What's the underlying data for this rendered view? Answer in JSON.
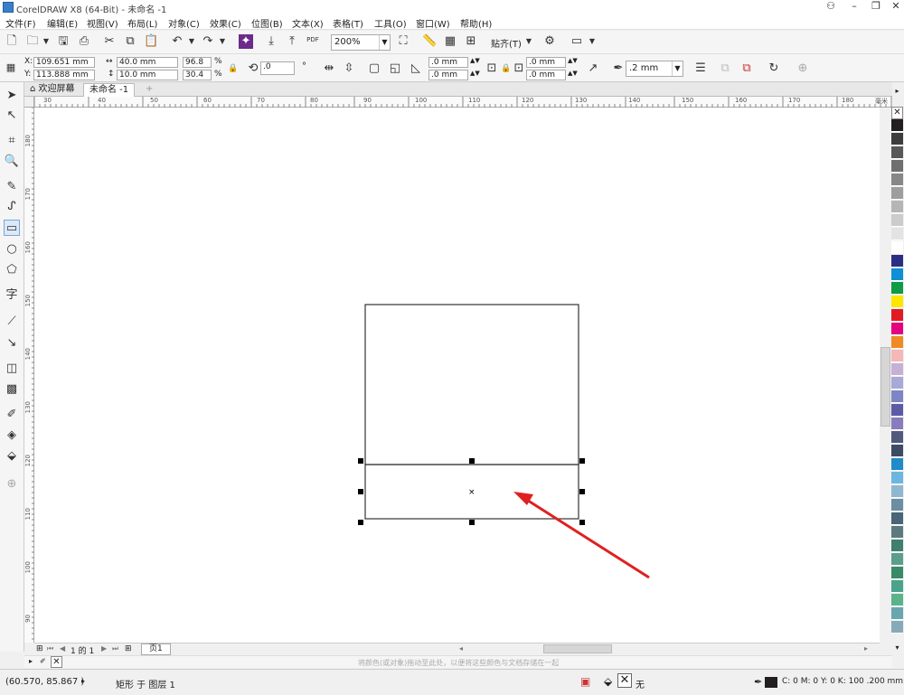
{
  "window": {
    "title": "CorelDRAW X8 (64-Bit) - 未命名 -1"
  },
  "menu": [
    "文件(F)",
    "编辑(E)",
    "视图(V)",
    "布局(L)",
    "对象(C)",
    "效果(C)",
    "位图(B)",
    "文本(X)",
    "表格(T)",
    "工具(O)",
    "窗口(W)",
    "帮助(H)"
  ],
  "toolbar": {
    "zoom": "200%",
    "snap_label": "贴齐(T)",
    "pdf_label": "PDF"
  },
  "propbar": {
    "x_label": "X:",
    "x_value": "109.651 mm",
    "y_label": "Y:",
    "y_value": "113.888 mm",
    "width_value": "40.0 mm",
    "height_value": "10.0 mm",
    "scale_x": "96.8",
    "scale_y": "30.4",
    "percent": "%",
    "rotation": ".0",
    "rotation_unit": "°",
    "corner_1": ".0 mm",
    "corner_2": ".0 mm",
    "corner_3": ".0 mm",
    "corner_4": ".0 mm",
    "outline_width": ".2 mm"
  },
  "tabs": {
    "welcome": "欢迎屏幕",
    "document": "未命名 -1",
    "add": "+"
  },
  "ruler": {
    "h_ticks": [
      "30",
      "40",
      "50",
      "60",
      "70",
      "80",
      "90",
      "100",
      "110",
      "120",
      "130",
      "140",
      "150",
      "160",
      "170",
      "180"
    ],
    "h_unit": "毫米",
    "v_ticks": [
      "180",
      "170",
      "160",
      "150",
      "140",
      "130",
      "120",
      "110",
      "100",
      "90"
    ]
  },
  "pagenav": {
    "page_count": "1 的 1",
    "page_tab": "页1"
  },
  "hint": "将颜色(或对象)拖动至此处，以便将这些颜色与文档存储在一起",
  "status": {
    "coords": "(60.570, 85.867 )",
    "object_info": "矩形 于 图层 1",
    "fill_label": "无",
    "outline_info": "C: 0 M: 0 Y: 0 K: 100  .200 mm"
  },
  "colors": {
    "arrow": "#e02020",
    "palette": [
      "#231f20",
      "#3d3d3d",
      "#585858",
      "#6f6f6f",
      "#878787",
      "#9e9e9e",
      "#b5b5b5",
      "#cccccc",
      "#e3e3e3",
      "#ffffff",
      "#2b2e83",
      "#0f8fd6",
      "#0d9b45",
      "#ffe600",
      "#e11b22",
      "#e4007f",
      "#f08a24",
      "#f5b7b7",
      "#c7b0d6",
      "#a7a9d6",
      "#7c86c6",
      "#5d5aa6",
      "#8a7bbf",
      "#4f5a7c",
      "#3e4b65",
      "#1f8bc9",
      "#6cb6e0",
      "#8fb8cf",
      "#6b8ea3",
      "#496577",
      "#5c7a7e",
      "#3f7f6f",
      "#5c9e8a",
      "#3a8a6a",
      "#4aa38a",
      "#5bb38a",
      "#6aa6b0",
      "#88aab8"
    ]
  }
}
